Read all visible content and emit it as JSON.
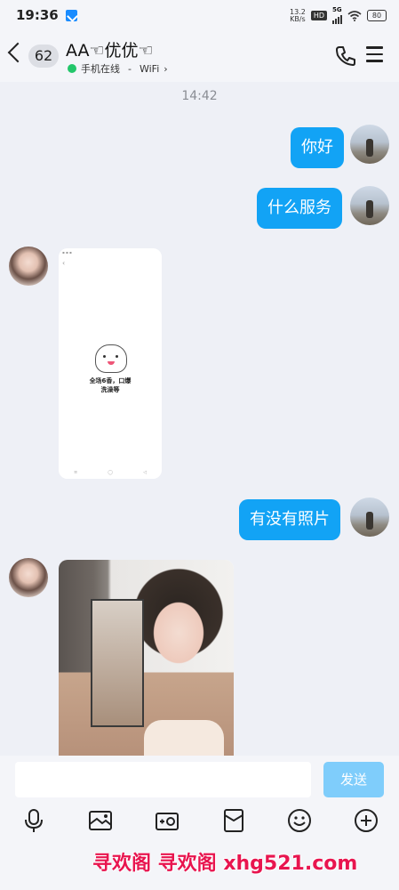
{
  "status_bar": {
    "time": "19:36",
    "net_speed_value": "13.2",
    "net_speed_unit": "KB/s",
    "hd_label": "HD",
    "network_type": "5G",
    "battery": "80"
  },
  "header": {
    "unread_count": "62",
    "contact_name": "AA☜优优☜",
    "presence": "手机在线",
    "separator": "-",
    "network": "WiFi"
  },
  "chat": {
    "timestamp": "14:42",
    "messages": [
      {
        "from": "self",
        "type": "text",
        "text": "你好"
      },
      {
        "from": "self",
        "type": "text",
        "text": "什么服务"
      },
      {
        "from": "peer",
        "type": "image",
        "caption": "全场6香，口爆\n洗澡等"
      },
      {
        "from": "self",
        "type": "text",
        "text": "有没有照片"
      },
      {
        "from": "peer",
        "type": "image",
        "caption": ""
      }
    ]
  },
  "composer": {
    "placeholder": "",
    "send_label": "发送",
    "tools": [
      "mic-icon",
      "image-icon",
      "camera-icon",
      "red-packet-icon",
      "emoji-icon",
      "plus-icon"
    ]
  },
  "watermark": {
    "text": "寻欢阁 寻欢阁 xhg521.com",
    "color": "#e8154f"
  },
  "colors": {
    "bubble": "#12a3f5",
    "send_disabled": "#7fcdfb",
    "online": "#23c66a"
  }
}
